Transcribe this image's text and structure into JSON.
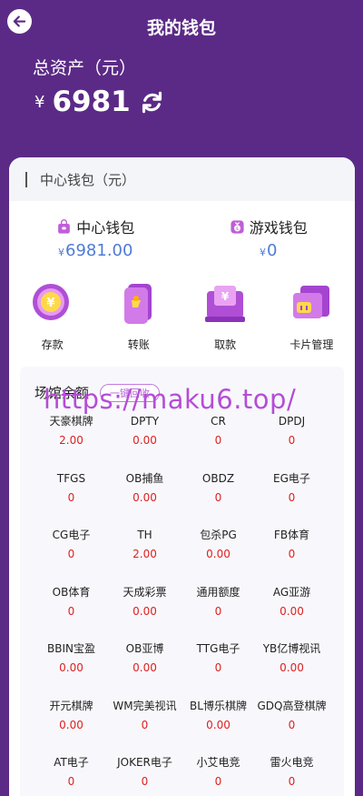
{
  "header": {
    "title": "我的钱包",
    "total_label": "总资产（元）",
    "currency": "¥",
    "total_amount": "6981"
  },
  "center_card": {
    "title": "中心钱包（元）",
    "wallets": [
      {
        "name": "中心钱包",
        "currency": "¥",
        "amount": "6981.00",
        "icon": "bag-icon"
      },
      {
        "name": "游戏钱包",
        "currency": "¥",
        "amount": "0",
        "icon": "money-bag-icon"
      }
    ],
    "actions": [
      {
        "label": "存款",
        "icon": "deposit-coin-icon"
      },
      {
        "label": "转账",
        "icon": "transfer-phone-icon"
      },
      {
        "label": "取款",
        "icon": "withdraw-atm-icon"
      },
      {
        "label": "卡片管理",
        "icon": "card-manage-icon"
      }
    ]
  },
  "venue": {
    "title": "场馆余额",
    "recover_label": "一键回收",
    "items": [
      {
        "name": "天豪棋牌",
        "value": "2.00"
      },
      {
        "name": "DPTY",
        "value": "0.00"
      },
      {
        "name": "CR",
        "value": "0"
      },
      {
        "name": "DPDJ",
        "value": "0"
      },
      {
        "name": "TFGS",
        "value": "0"
      },
      {
        "name": "OB捕鱼",
        "value": "0.00"
      },
      {
        "name": "OBDZ",
        "value": "0"
      },
      {
        "name": "EG电子",
        "value": "0"
      },
      {
        "name": "CG电子",
        "value": "0"
      },
      {
        "name": "TH",
        "value": "2.00"
      },
      {
        "name": "包杀PG",
        "value": "0.00"
      },
      {
        "name": "FB体育",
        "value": "0"
      },
      {
        "name": "OB体育",
        "value": "0"
      },
      {
        "name": "天成彩票",
        "value": "0.00"
      },
      {
        "name": "通用额度",
        "value": "0"
      },
      {
        "name": "AG亚游",
        "value": "0.00"
      },
      {
        "name": "BBIN宝盈",
        "value": "0.00"
      },
      {
        "name": "OB亚博",
        "value": "0.00"
      },
      {
        "name": "TTG电子",
        "value": "0"
      },
      {
        "name": "YB亿博视讯",
        "value": "0.00"
      },
      {
        "name": "开元棋牌",
        "value": "0.00"
      },
      {
        "name": "WM完美视讯",
        "value": "0"
      },
      {
        "name": "BL博乐棋牌",
        "value": "0.00"
      },
      {
        "name": "GDQ高登棋牌",
        "value": "0"
      },
      {
        "name": "AT电子",
        "value": "0"
      },
      {
        "name": "JOKER电子",
        "value": "0"
      },
      {
        "name": "小艾电竞",
        "value": "0"
      },
      {
        "name": "雷火电竞",
        "value": "0"
      }
    ]
  },
  "watermark": "https://maku6.top/",
  "colors": {
    "header_bg": "#5b2a86",
    "amount_blue": "#4f7bd6",
    "value_red": "#e02020",
    "accent_purple": "#b467d8"
  }
}
